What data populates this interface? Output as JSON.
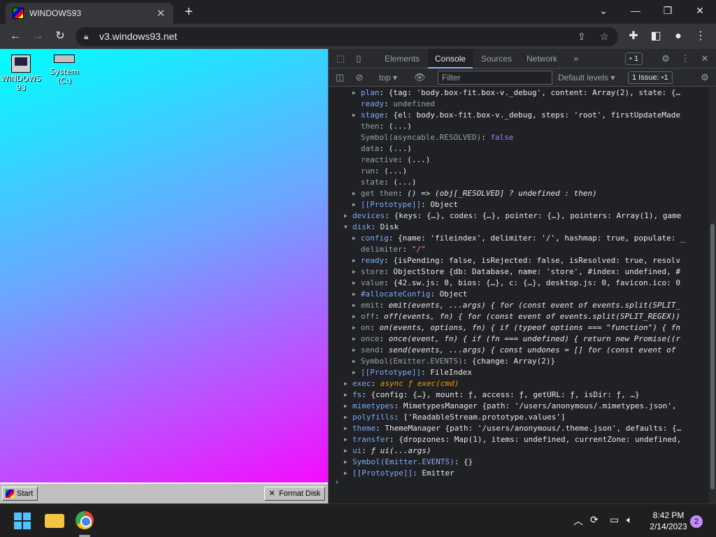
{
  "browser": {
    "tab_title": "WINDOWS93",
    "url": "v3.windows93.net"
  },
  "desktop": {
    "icons": [
      {
        "label": "WINDOWS 93"
      },
      {
        "label": "System (C:)"
      }
    ],
    "start_label": "Start",
    "format_label": "Format Disk"
  },
  "devtools": {
    "tabs": [
      "Elements",
      "Console",
      "Sources",
      "Network"
    ],
    "active_tab": "Console",
    "messages_badge": "1",
    "context": "top",
    "filter_placeholder": "Filter",
    "levels": "Default levels",
    "issues_label": "1 Issue:",
    "issues_count": "1"
  },
  "taskbar": {
    "time": "8:42 PM",
    "date": "2/14/2023",
    "notifications": "2"
  },
  "console_lines": [
    {
      "indent": 1,
      "tri": "r",
      "key": "plan",
      "text": "{tag: 'body.box-fit.box-v._debug', content: Array(2), state: {…"
    },
    {
      "indent": 1,
      "tri": "",
      "key": "ready",
      "text": "undefined"
    },
    {
      "indent": 1,
      "tri": "r",
      "key": "stage",
      "text": "{el: body.box-fit.box-v._debug, steps: 'root', firstUpdateMade"
    },
    {
      "indent": 1,
      "tri": "",
      "key": "then",
      "text": "(...)"
    },
    {
      "indent": 1,
      "tri": "",
      "key": "Symbol(asyncable.RESOLVED)",
      "text": "false"
    },
    {
      "indent": 1,
      "tri": "",
      "key": "data",
      "text": "(...)"
    },
    {
      "indent": 1,
      "tri": "",
      "key": "reactive",
      "text": "(...)"
    },
    {
      "indent": 1,
      "tri": "",
      "key": "run",
      "text": "(...)"
    },
    {
      "indent": 1,
      "tri": "",
      "key": "state",
      "text": "(...)"
    },
    {
      "indent": 1,
      "tri": "r",
      "key": "get then",
      "text": "() => (obj[_RESOLVED] ? undefined : then)"
    },
    {
      "indent": 1,
      "tri": "r",
      "key": "[[Prototype]]",
      "text": "Object"
    },
    {
      "indent": 0,
      "tri": "r",
      "key": "devices",
      "text": "{keys: {…}, codes: {…}, pointer: {…}, pointers: Array(1), game"
    },
    {
      "indent": 0,
      "tri": "d",
      "key": "disk",
      "text": "Disk"
    },
    {
      "indent": 1,
      "tri": "r",
      "key": "config",
      "text": "{name: 'fileindex', delimiter: '/', hashmap: true, populate: _"
    },
    {
      "indent": 1,
      "tri": "",
      "key": "delimiter",
      "text": "\"/\""
    },
    {
      "indent": 1,
      "tri": "r",
      "key": "ready",
      "text": "{isPending: false, isRejected: false, isResolved: true, resolv"
    },
    {
      "indent": 1,
      "tri": "r",
      "key": "store",
      "text": "ObjectStore {db: Database, name: 'store', #index: undefined, #"
    },
    {
      "indent": 1,
      "tri": "r",
      "key": "value",
      "text": "{42.sw.js: 0, bios: {…}, c: {…}, desktop.js: 0, favicon.ico: 0"
    },
    {
      "indent": 1,
      "tri": "r",
      "key": "#allocateConfig",
      "text": "Object"
    },
    {
      "indent": 1,
      "tri": "r",
      "key": "emit",
      "text": "emit(events, ...args) { for (const event of events.split(SPLIT_"
    },
    {
      "indent": 1,
      "tri": "r",
      "key": "off",
      "text": "off(events, fn) { for (const event of events.split(SPLIT_REGEX))"
    },
    {
      "indent": 1,
      "tri": "r",
      "key": "on",
      "text": "on(events, options, fn) { if (typeof options === \"function\") { fn"
    },
    {
      "indent": 1,
      "tri": "r",
      "key": "once",
      "text": "once(event, fn) { if (fn === undefined) { return new Promise((r"
    },
    {
      "indent": 1,
      "tri": "r",
      "key": "send",
      "text": "send(events, ...args) { const undones = [] for (const event of"
    },
    {
      "indent": 1,
      "tri": "r",
      "key": "Symbol(Emitter.EVENTS)",
      "text": "{change: Array(2)}"
    },
    {
      "indent": 1,
      "tri": "r",
      "key": "[[Prototype]]",
      "text": "FileIndex"
    },
    {
      "indent": 0,
      "tri": "r",
      "key": "exec",
      "text": "async ƒ exec(cmd)"
    },
    {
      "indent": 0,
      "tri": "r",
      "key": "fs",
      "text": "{config: {…}, mount: ƒ, access: ƒ, getURL: ƒ, isDir: ƒ, …}"
    },
    {
      "indent": 0,
      "tri": "r",
      "key": "mimetypes",
      "text": "MimetypesManager {path: '/users/anonymous/.mimetypes.json',"
    },
    {
      "indent": 0,
      "tri": "r",
      "key": "polyfills",
      "text": "['ReadableStream.prototype.values']"
    },
    {
      "indent": 0,
      "tri": "r",
      "key": "theme",
      "text": "ThemeManager {path: '/users/anonymous/.theme.json', defaults: {…"
    },
    {
      "indent": 0,
      "tri": "r",
      "key": "transfer",
      "text": "{dropzones: Map(1), items: undefined, currentZone: undefined,"
    },
    {
      "indent": 0,
      "tri": "r",
      "key": "ui",
      "text": "ƒ ui(...args)"
    },
    {
      "indent": 0,
      "tri": "r",
      "key": "Symbol(Emitter.EVENTS)",
      "text": "{}"
    },
    {
      "indent": 0,
      "tri": "r",
      "key": "[[Prototype]]",
      "text": "Emitter"
    }
  ]
}
